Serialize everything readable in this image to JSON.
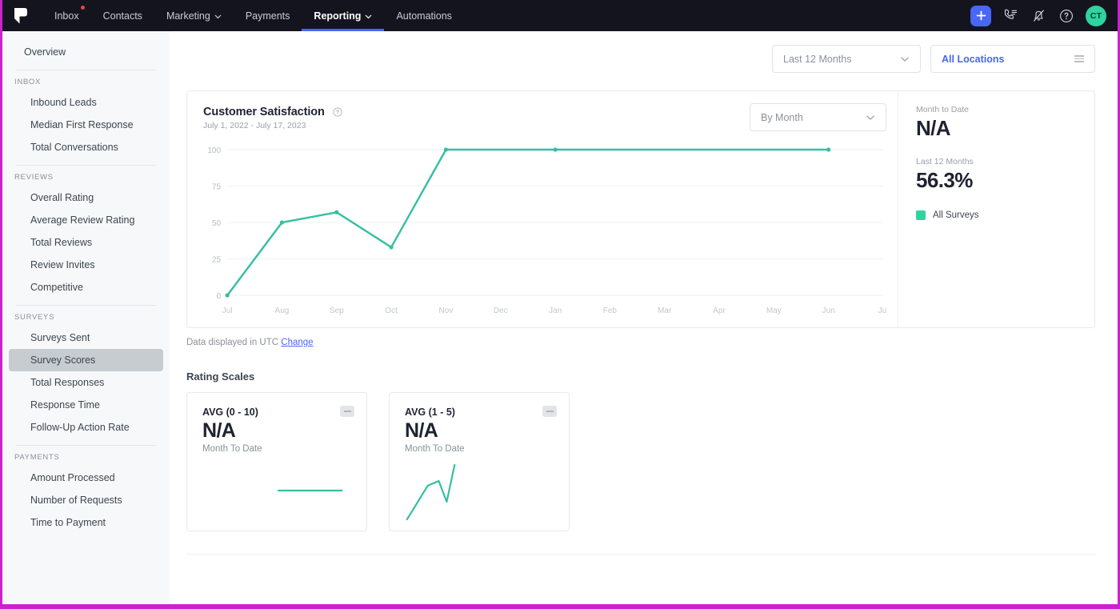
{
  "topnav": {
    "logo_icon": "podium-flag-logo",
    "items": [
      {
        "label": "Inbox",
        "has_caret": false,
        "has_dot": true,
        "active": false
      },
      {
        "label": "Contacts",
        "has_caret": false,
        "has_dot": false,
        "active": false
      },
      {
        "label": "Marketing",
        "has_caret": true,
        "has_dot": false,
        "active": false
      },
      {
        "label": "Payments",
        "has_caret": false,
        "has_dot": false,
        "active": false
      },
      {
        "label": "Reporting",
        "has_caret": true,
        "has_dot": false,
        "active": true
      },
      {
        "label": "Automations",
        "has_caret": false,
        "has_dot": false,
        "active": false
      }
    ],
    "actions": {
      "add_icon": "plus-icon",
      "calls_icon": "phone-list-icon",
      "notifications_icon": "bell-slash-icon",
      "help_icon": "question-circle-icon"
    },
    "avatar_initials": "CT",
    "accent_blue": "#4a66f5",
    "avatar_green": "#2fd49f"
  },
  "sidebar": {
    "overview_label": "Overview",
    "sections": [
      {
        "heading": "INBOX",
        "items": [
          "Inbound Leads",
          "Median First Response",
          "Total Conversations"
        ]
      },
      {
        "heading": "REVIEWS",
        "items": [
          "Overall Rating",
          "Average Review Rating",
          "Total Reviews",
          "Review Invites",
          "Competitive"
        ]
      },
      {
        "heading": "SURVEYS",
        "items": [
          "Surveys Sent",
          "Survey Scores",
          "Total Responses",
          "Response Time",
          "Follow-Up Action Rate"
        ]
      },
      {
        "heading": "PAYMENTS",
        "items": [
          "Amount Processed",
          "Number of Requests",
          "Time to Payment"
        ]
      }
    ],
    "active_item": "Survey Scores"
  },
  "filters": {
    "date_range": {
      "value": "Last 12 Months",
      "caret_icon": "chevron-down-icon"
    },
    "locations": {
      "value": "All Locations",
      "menu_icon": "hamburger-icon"
    }
  },
  "card": {
    "title": "Customer Satisfaction",
    "info_icon": "info-circle-icon",
    "subtitle": "July 1, 2022 - July 17, 2023",
    "grouping": {
      "value": "By Month",
      "caret_icon": "chevron-down-icon"
    },
    "stats": [
      {
        "label": "Month to Date",
        "value": "N/A"
      },
      {
        "label": "Last 12 Months",
        "value": "56.3%"
      }
    ],
    "legend": {
      "label": "All Surveys",
      "color": "#2fd49f"
    }
  },
  "chart_data": {
    "type": "line",
    "title": "Customer Satisfaction",
    "subtitle": "July 1, 2022 - July 17, 2023",
    "xlabel": "",
    "ylabel": "",
    "ylim": [
      0,
      100
    ],
    "yticks": [
      0,
      25,
      50,
      75,
      100
    ],
    "grid": true,
    "legend_position": "right",
    "line_color": "#35bfa2",
    "categories": [
      "Jul",
      "Aug",
      "Sep",
      "Oct",
      "Nov",
      "Dec",
      "Jan",
      "Feb",
      "Mar",
      "Apr",
      "May",
      "Jun",
      "Jul"
    ],
    "series": [
      {
        "name": "All Surveys",
        "values": [
          0,
          50,
          57,
          33,
          100,
          100,
          100,
          100,
          100,
          100,
          100,
          100,
          null
        ],
        "marker_points": [
          "Jul",
          "Aug",
          "Sep",
          "Oct",
          "Nov",
          "Jan",
          "Jun"
        ]
      }
    ]
  },
  "utc_note": {
    "text": "Data displayed in UTC",
    "link": "Change"
  },
  "rating_scales": {
    "section_title": "Rating Scales",
    "cards": [
      {
        "title": "AVG (0 - 10)",
        "value": "N/A",
        "period": "Month To Date",
        "trend_icon": "flat-trend-badge",
        "sparkline": "flat"
      },
      {
        "title": "AVG (1 - 5)",
        "value": "N/A",
        "period": "Month To Date",
        "trend_icon": "flat-trend-badge",
        "sparkline": "rising-zigzag"
      }
    ]
  }
}
